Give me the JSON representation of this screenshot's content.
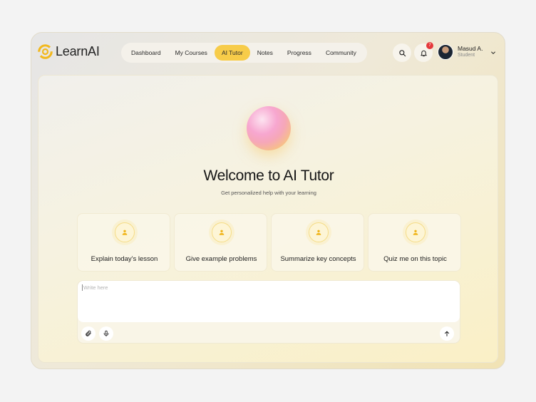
{
  "brand": {
    "name": "LearnAI",
    "accent": "#f7cc49"
  },
  "nav": {
    "items": [
      {
        "label": "Dashboard"
      },
      {
        "label": "My Courses"
      },
      {
        "label": "AI Tutor",
        "active": true
      },
      {
        "label": "Notes"
      },
      {
        "label": "Progress"
      },
      {
        "label": "Community"
      }
    ]
  },
  "header": {
    "search_icon": "search-icon",
    "notifications": {
      "icon": "bell-icon",
      "count": "7"
    },
    "user": {
      "name": "Masud A.",
      "role": "Student"
    }
  },
  "main": {
    "title": "Welcome to AI Tutor",
    "subtitle": "Get personalized help with your learning",
    "suggestions": [
      {
        "label": "Explain today's lesson",
        "icon": "user-icon"
      },
      {
        "label": "Give example problems",
        "icon": "user-icon"
      },
      {
        "label": "Summarize key concepts",
        "icon": "user-icon"
      },
      {
        "label": "Quiz me on this topic",
        "icon": "user-icon"
      }
    ],
    "composer": {
      "placeholder": "Write here",
      "attach_icon": "paperclip-icon",
      "mic_icon": "microphone-icon",
      "send_icon": "arrow-up-icon"
    }
  }
}
